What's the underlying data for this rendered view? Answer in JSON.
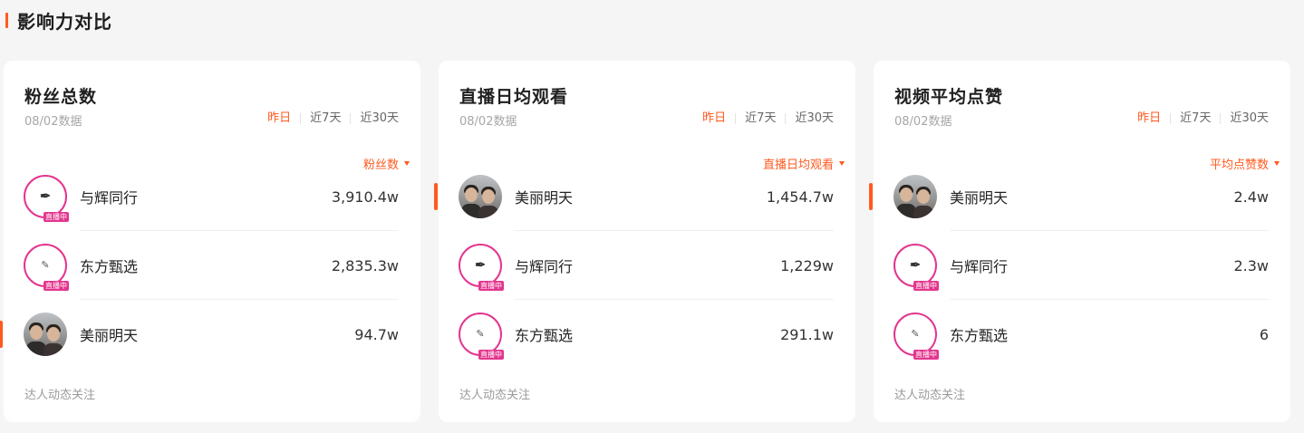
{
  "section": {
    "title": "影响力对比"
  },
  "accent_color": "#ff5a1f",
  "live_color": "#e3358e",
  "cards": [
    {
      "title": "粉丝总数",
      "date": "08/02数据",
      "tabs": [
        "昨日",
        "近7天",
        "近30天"
      ],
      "active_tab": "昨日",
      "sort_label": "粉丝数",
      "footer": "达人动态关注",
      "rows": [
        {
          "name": "与辉同行",
          "value": "3,910.4w",
          "avatar": "yuhui-logo",
          "live_badge": "直播中",
          "marked": false
        },
        {
          "name": "东方甄选",
          "value": "2,835.3w",
          "avatar": "dongfang-logo",
          "live_badge": "直播中",
          "marked": false
        },
        {
          "name": "美丽明天",
          "value": "94.7w",
          "avatar": "photo",
          "live_badge": "",
          "marked": true
        }
      ]
    },
    {
      "title": "直播日均观看",
      "date": "08/02数据",
      "tabs": [
        "昨日",
        "近7天",
        "近30天"
      ],
      "active_tab": "昨日",
      "sort_label": "直播日均观看",
      "footer": "达人动态关注",
      "rows": [
        {
          "name": "美丽明天",
          "value": "1,454.7w",
          "avatar": "photo",
          "live_badge": "",
          "marked": true
        },
        {
          "name": "与辉同行",
          "value": "1,229w",
          "avatar": "yuhui-logo",
          "live_badge": "直播中",
          "marked": false
        },
        {
          "name": "东方甄选",
          "value": "291.1w",
          "avatar": "dongfang-logo",
          "live_badge": "直播中",
          "marked": false
        }
      ]
    },
    {
      "title": "视频平均点赞",
      "date": "08/02数据",
      "tabs": [
        "昨日",
        "近7天",
        "近30天"
      ],
      "active_tab": "昨日",
      "sort_label": "平均点赞数",
      "footer": "达人动态关注",
      "rows": [
        {
          "name": "美丽明天",
          "value": "2.4w",
          "avatar": "photo",
          "live_badge": "",
          "marked": true
        },
        {
          "name": "与辉同行",
          "value": "2.3w",
          "avatar": "yuhui-logo",
          "live_badge": "直播中",
          "marked": false
        },
        {
          "name": "东方甄选",
          "value": "6",
          "avatar": "dongfang-logo",
          "live_badge": "直播中",
          "marked": false
        }
      ]
    }
  ]
}
